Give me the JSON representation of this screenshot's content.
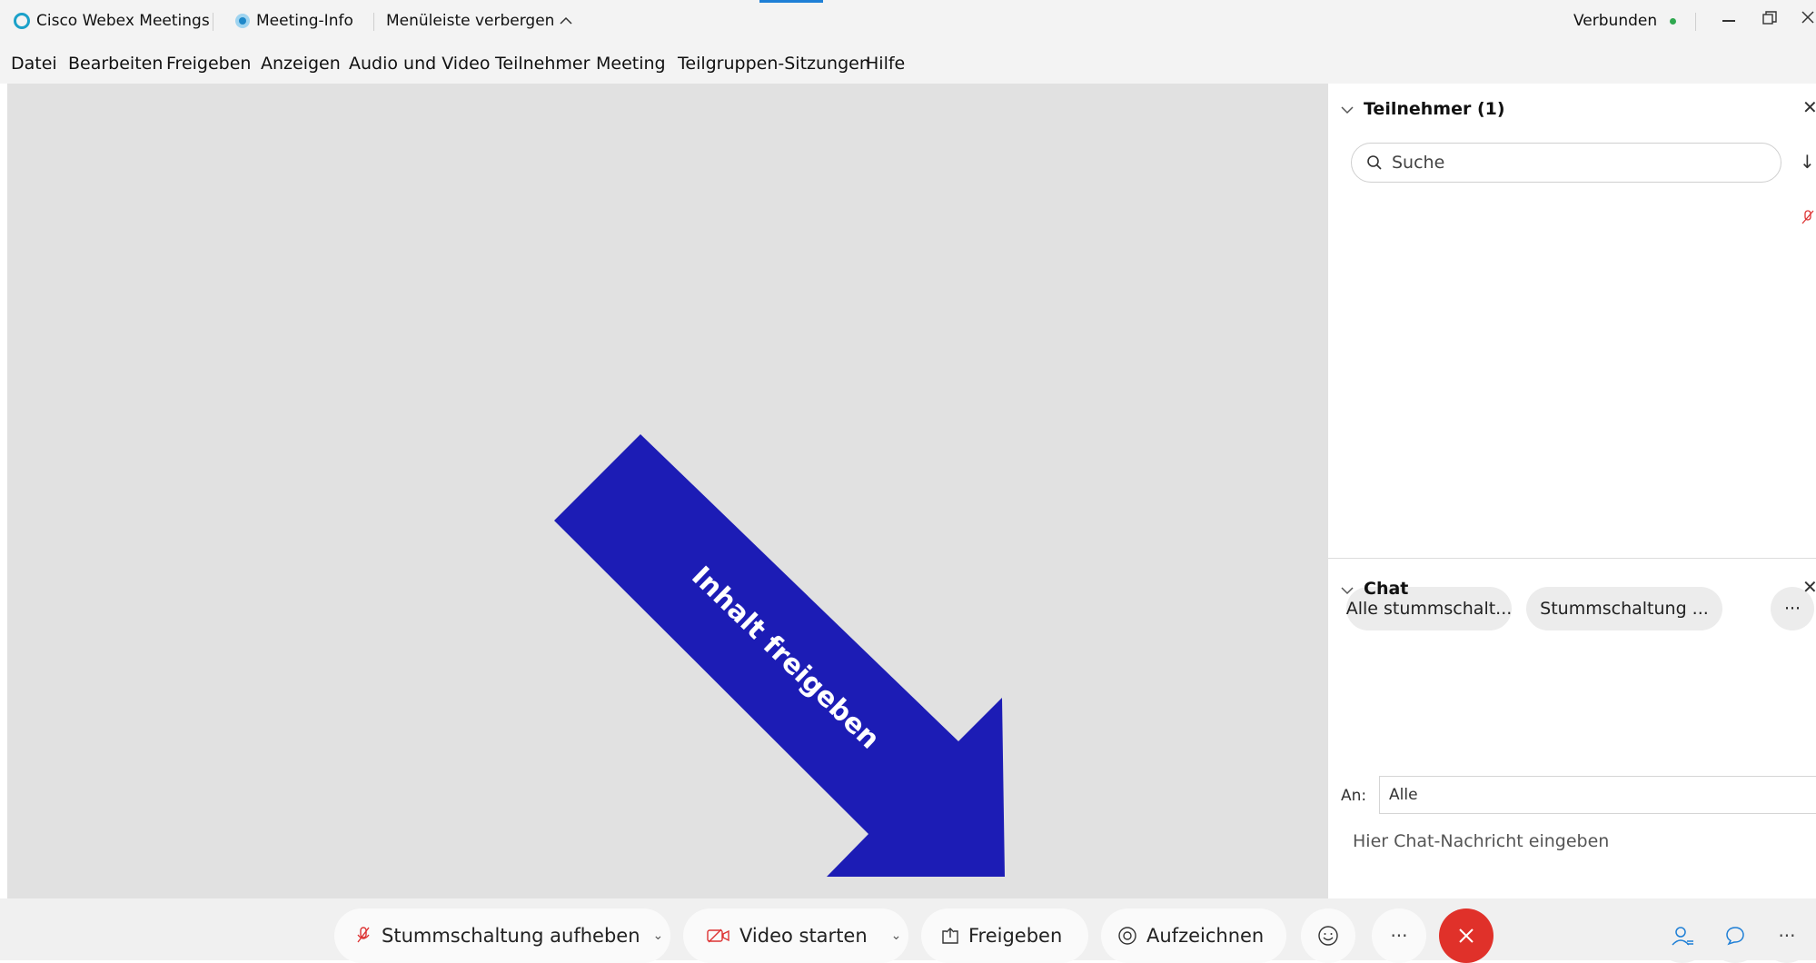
{
  "titlebar": {
    "app_name": "Cisco Webex Meetings",
    "meeting_info": "Meeting-Info",
    "hide_menu": "Menüleiste verbergen",
    "status": "Verbunden",
    "status_color": "#2fa84f"
  },
  "menu": {
    "items": [
      "Datei",
      "Bearbeiten",
      "Freigeben",
      "Anzeigen",
      "Audio und Video",
      "Teilnehmer",
      "Meeting",
      "Teilgruppen-Sitzungen",
      "Hilfe"
    ]
  },
  "annotation": {
    "text": "Inhalt freigeben",
    "color": "#1c1cb5"
  },
  "participants": {
    "title": "Teilnehmer (1)",
    "search_placeholder": "Suche",
    "mute_all": "Alle stummschalt...",
    "unmute": "Stummschaltung ...",
    "more": "···"
  },
  "chat": {
    "title": "Chat",
    "to_label": "An:",
    "to_value": "Alle",
    "input_placeholder": "Hier Chat-Nachricht eingeben"
  },
  "toolbar": {
    "unmute": "Stummschaltung aufheben",
    "video": "Video starten",
    "share": "Freigeben",
    "record": "Aufzeichnen",
    "more": "···",
    "end_color": "#e0312a",
    "more_right": "···"
  }
}
